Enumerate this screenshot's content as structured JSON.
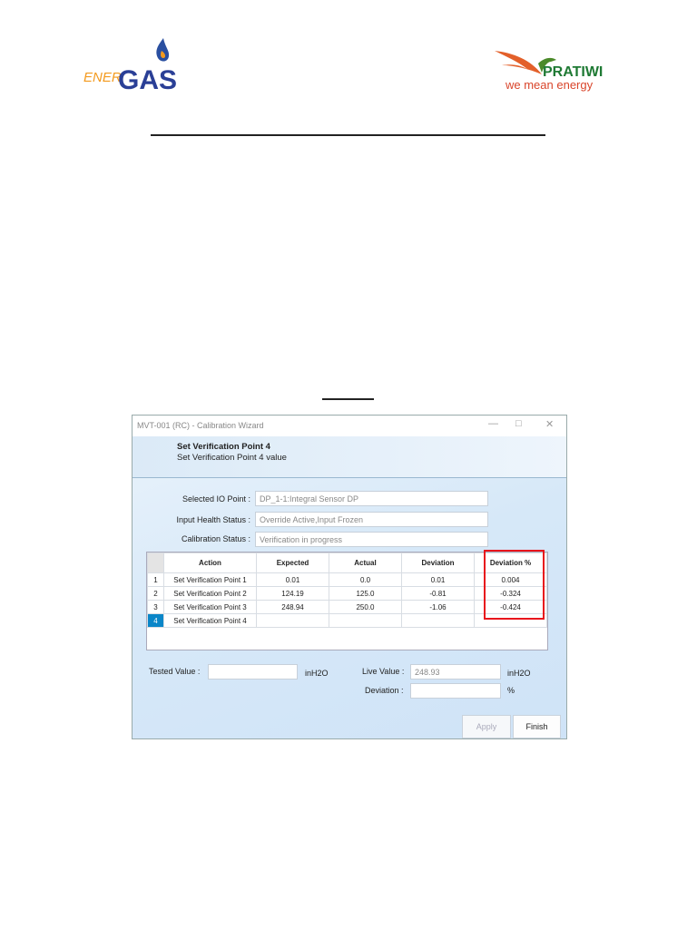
{
  "logos": {
    "left": "ENERGAS",
    "right_name": "PRATIWI",
    "right_tagline": "we mean energy"
  },
  "window": {
    "title": "MVT-001 (RC) - Calibration Wizard",
    "header_title": "Set Verification Point 4",
    "header_subtitle": "Set Verification Point 4 value",
    "fields": [
      {
        "label": "Selected IO Point :",
        "value": "DP_1-1:Integral Sensor DP"
      },
      {
        "label": "Input Health Status :",
        "value": "Override Active,Input Frozen"
      },
      {
        "label": "Calibration Status :",
        "value": "Verification in progress"
      }
    ],
    "table": {
      "columns": [
        "Action",
        "Expected",
        "Actual",
        "Deviation",
        "Deviation %"
      ],
      "rows": [
        {
          "n": "1",
          "cells": [
            "Set Verification Point 1",
            "0.01",
            "0.0",
            "0.01",
            "0.004"
          ]
        },
        {
          "n": "2",
          "cells": [
            "Set Verification Point 2",
            "124.19",
            "125.0",
            "-0.81",
            "-0.324"
          ]
        },
        {
          "n": "3",
          "cells": [
            "Set Verification Point 3",
            "248.94",
            "250.0",
            "-1.06",
            "-0.424"
          ]
        },
        {
          "n": "4",
          "cells": [
            "Set Verification Point 4",
            "",
            "",
            "",
            ""
          ]
        }
      ]
    },
    "tested_label": "Tested Value :",
    "tested_value": "",
    "tested_unit": "inH2O",
    "live_label": "Live Value :",
    "live_value": "248.93",
    "live_unit": "inH2O",
    "deviation_label": "Deviation :",
    "deviation_value": "",
    "deviation_unit": "%",
    "apply": "Apply",
    "finish": "Finish"
  },
  "colors": {
    "highlight": "#e8141c",
    "selected_row": "#0a86c8"
  }
}
